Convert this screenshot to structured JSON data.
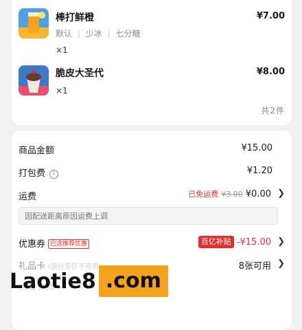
{
  "order_items": [
    {
      "name": "棒打鲜橙",
      "price": "¥7.00",
      "options": [
        "默认",
        "少冰",
        "七分糖"
      ],
      "quantity": "×1"
    },
    {
      "name": "脆皮大圣代",
      "price": "¥8.00",
      "quantity": "×1"
    }
  ],
  "item_count": "共2件",
  "summary": {
    "goods_amount": {
      "label": "商品金额",
      "value": "¥15.00"
    },
    "packing_fee": {
      "label": "打包费",
      "info_icon": "i",
      "value": "¥1.20"
    },
    "shipping": {
      "label": "运费",
      "waived_text": "已免运费",
      "original": "¥3.00",
      "value": "¥0.00",
      "hint": "因配送距离原因运费上调"
    },
    "coupon": {
      "label": "优惠券",
      "recommend_tag": "已选推荐优惠",
      "subsidy_tag": "百亿补贴",
      "value": "-¥15.00"
    },
    "gift_card": {
      "label": "礼品卡",
      "label_hint": "(部分专区不可用)",
      "value": "8张可用"
    },
    "next_row_label": "自备餐具"
  },
  "watermark": {
    "left": "Laotie8",
    "right": ".com"
  },
  "colors": {
    "accent_red": "#e0312e",
    "watermark_orange": "#f5a21c",
    "page_bg": "#f1f1f1"
  },
  "icons": [
    "chevron-right-icon",
    "info-icon"
  ]
}
